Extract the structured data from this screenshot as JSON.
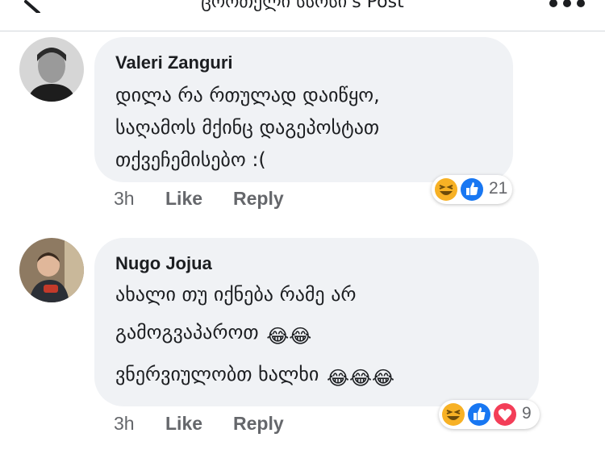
{
  "header": {
    "title": "ცოოთელი სსოსი's Post"
  },
  "comments": [
    {
      "author": "Valeri Zanguri",
      "lines": [
        "დილა რა რთულად დაიწყო,",
        "საღამოს მქინც დაგეპოსტათ",
        "თქვეჩემისებო :("
      ],
      "time": "3h",
      "like_label": "Like",
      "reply_label": "Reply",
      "reactions": [
        "haha",
        "like"
      ],
      "reaction_count": "21"
    },
    {
      "author": "Nugo Jojua",
      "lines": [
        "ახალი თუ იქნება რამე არ",
        "გამოგვაპაროთ",
        "ვნერვიულობთ ხალხი"
      ],
      "line_emojis": [
        "",
        "😂😂",
        "😂😂😂"
      ],
      "time": "3h",
      "like_label": "Like",
      "reply_label": "Reply",
      "reactions": [
        "haha",
        "like",
        "love"
      ],
      "reaction_count": "9"
    }
  ],
  "colors": {
    "bubble": "#f0f2f5",
    "like_blue": "#1877f2",
    "love_red": "#f33e58",
    "haha_yellow": "#f7b125"
  }
}
